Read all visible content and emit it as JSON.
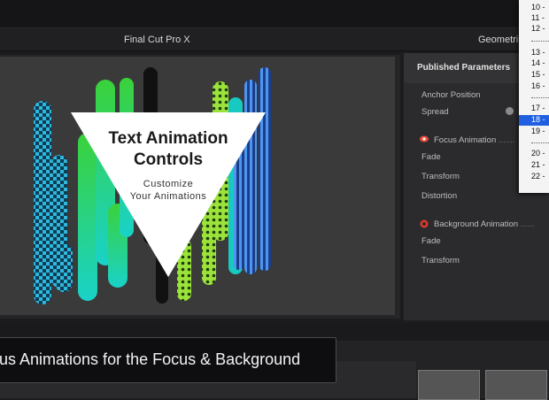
{
  "window": {
    "app_title": "Final Cut Pro X",
    "inspector_title": "Geometric"
  },
  "viewer": {
    "title_line1": "Text Animation",
    "title_line2": "Controls",
    "subtitle_line1": "Customize",
    "subtitle_line2": "Your Animations"
  },
  "caption": {
    "text": "us Animations for the Focus & Background"
  },
  "inspector": {
    "header": "Published Parameters",
    "params": {
      "anchor_position": "Anchor Position",
      "spread": "Spread",
      "focus_animation": "Focus Animation",
      "focus_dots": ".......",
      "focus_fade": "Fade",
      "focus_transform": "Transform",
      "focus_distortion": "Distortion",
      "background_animation": "Background Animation",
      "background_dots": "......",
      "background_fade": "Fade",
      "background_transform": "Transform"
    }
  },
  "dropdown": {
    "items": [
      {
        "label": "10 -"
      },
      {
        "label": "11 -"
      },
      {
        "label": "12 -"
      },
      {
        "label": "13 -"
      },
      {
        "label": "14 -"
      },
      {
        "label": "15 -"
      },
      {
        "label": "16 -"
      },
      {
        "label": "17 -"
      },
      {
        "label": "18 -",
        "selected": true
      },
      {
        "label": "19 -"
      },
      {
        "label": "20 -"
      },
      {
        "label": "21 -"
      },
      {
        "label": "22 -"
      }
    ]
  },
  "colors": {
    "accent_selected": "#1f5fe0",
    "focus_icon": "#e84b3a",
    "background_icon": "#e0392c"
  }
}
